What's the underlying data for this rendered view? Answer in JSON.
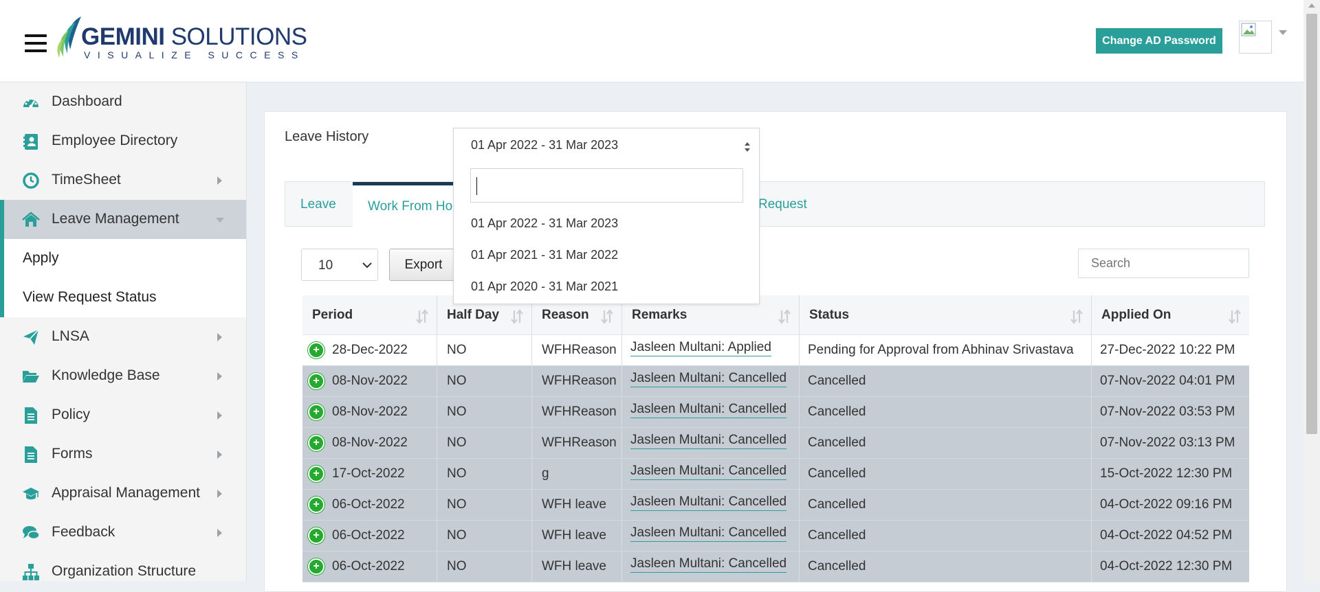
{
  "header": {
    "logo": {
      "brand": "GEMINI",
      "brand_suffix": "SOLUTIONS",
      "tagline": "VISUALIZE SUCCESS"
    },
    "change_password_label": "Change AD Password"
  },
  "sidebar": {
    "items": [
      {
        "label": "Dashboard",
        "icon": "dashboard-icon"
      },
      {
        "label": "Employee Directory",
        "icon": "address-book-icon"
      },
      {
        "label": "TimeSheet",
        "icon": "clock-icon"
      },
      {
        "label": "Leave Management",
        "icon": "home-icon"
      },
      {
        "label": "LNSA",
        "icon": "paper-plane-icon"
      },
      {
        "label": "Knowledge Base",
        "icon": "folder-open-icon"
      },
      {
        "label": "Policy",
        "icon": "document-icon"
      },
      {
        "label": "Forms",
        "icon": "document-icon"
      },
      {
        "label": "Appraisal Management",
        "icon": "graduation-cap-icon"
      },
      {
        "label": "Feedback",
        "icon": "comments-icon"
      },
      {
        "label": "Organization Structure",
        "icon": "sitemap-icon"
      }
    ],
    "submenu": [
      {
        "label": "Apply"
      },
      {
        "label": "View Request Status"
      }
    ]
  },
  "main": {
    "title": "Leave History",
    "tabs": [
      {
        "label": "Leave"
      },
      {
        "label": "Work From Ho"
      },
      {
        "label": "Request"
      }
    ],
    "page_size": "10",
    "export_label": "Export",
    "search_placeholder": "Search",
    "dropdown": {
      "selected": "01 Apr 2022 - 31 Mar 2023",
      "search_value": "",
      "options": [
        "01 Apr 2022 - 31 Mar 2023",
        "01 Apr 2021 - 31 Mar 2022",
        "01 Apr 2020 - 31 Mar 2021"
      ]
    },
    "table": {
      "columns": [
        "Period",
        "Half Day",
        "Reason",
        "Remarks",
        "Status",
        "Applied On"
      ],
      "rows": [
        {
          "period": "28-Dec-2022",
          "half_day": "NO",
          "reason": "WFHReason",
          "remarks": "Jasleen Multani: Applied",
          "status": "Pending for Approval from Abhinav Srivastava",
          "applied_on": "27-Dec-2022 10:22 PM"
        },
        {
          "period": "08-Nov-2022",
          "half_day": "NO",
          "reason": "WFHReason",
          "remarks": "Jasleen Multani: Cancelled",
          "status": "Cancelled",
          "applied_on": "07-Nov-2022 04:01 PM"
        },
        {
          "period": "08-Nov-2022",
          "half_day": "NO",
          "reason": "WFHReason",
          "remarks": "Jasleen Multani: Cancelled",
          "status": "Cancelled",
          "applied_on": "07-Nov-2022 03:53 PM"
        },
        {
          "period": "08-Nov-2022",
          "half_day": "NO",
          "reason": "WFHReason",
          "remarks": "Jasleen Multani: Cancelled",
          "status": "Cancelled",
          "applied_on": "07-Nov-2022 03:13 PM"
        },
        {
          "period": "17-Oct-2022",
          "half_day": "NO",
          "reason": "g",
          "remarks": "Jasleen Multani: Cancelled",
          "status": "Cancelled",
          "applied_on": "15-Oct-2022 12:30 PM"
        },
        {
          "period": "06-Oct-2022",
          "half_day": "NO",
          "reason": "WFH leave",
          "remarks": "Jasleen Multani: Cancelled",
          "status": "Cancelled",
          "applied_on": "04-Oct-2022 09:16 PM"
        },
        {
          "period": "06-Oct-2022",
          "half_day": "NO",
          "reason": "WFH leave",
          "remarks": "Jasleen Multani: Cancelled",
          "status": "Cancelled",
          "applied_on": "04-Oct-2022 04:52 PM"
        },
        {
          "period": "06-Oct-2022",
          "half_day": "NO",
          "reason": "WFH leave",
          "remarks": "Jasleen Multani: Cancelled",
          "status": "Cancelled",
          "applied_on": "04-Oct-2022 12:30 PM"
        }
      ]
    }
  },
  "colors": {
    "accent": "#2a9f9a",
    "tab_active_border": "#173b55",
    "row_highlight": "#c5ccd3",
    "expand_button": "#25a92f"
  }
}
